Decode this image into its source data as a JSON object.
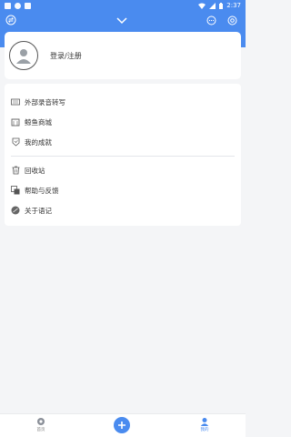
{
  "status_bar": {
    "time": "2:37",
    "left_icons": [
      "notification-icon",
      "app-icon",
      "app-icon-2"
    ],
    "right_icons": [
      "wifi-icon",
      "signal-icon",
      "battery-icon"
    ]
  },
  "header": {
    "background": "#4a8bef",
    "icons": {
      "left": "transfer-icon",
      "center": "chevron-down-icon",
      "right1": "chat-icon",
      "right2": "settings-icon"
    }
  },
  "profile": {
    "login_text": "登录/注册"
  },
  "menu": {
    "group1": [
      {
        "icon": "keyboard-icon",
        "label": "外部录音转写"
      },
      {
        "icon": "store-icon",
        "label": "鲸鱼商城"
      },
      {
        "icon": "achievement-icon",
        "label": "我的成就"
      }
    ],
    "group2": [
      {
        "icon": "trash-icon",
        "label": "回收站"
      },
      {
        "icon": "help-icon",
        "label": "帮助与反馈"
      },
      {
        "icon": "about-icon",
        "label": "关于语记"
      }
    ]
  },
  "bottom_nav": {
    "home_label": "首页",
    "mine_label": "我的",
    "fab_icon": "plus-icon"
  }
}
